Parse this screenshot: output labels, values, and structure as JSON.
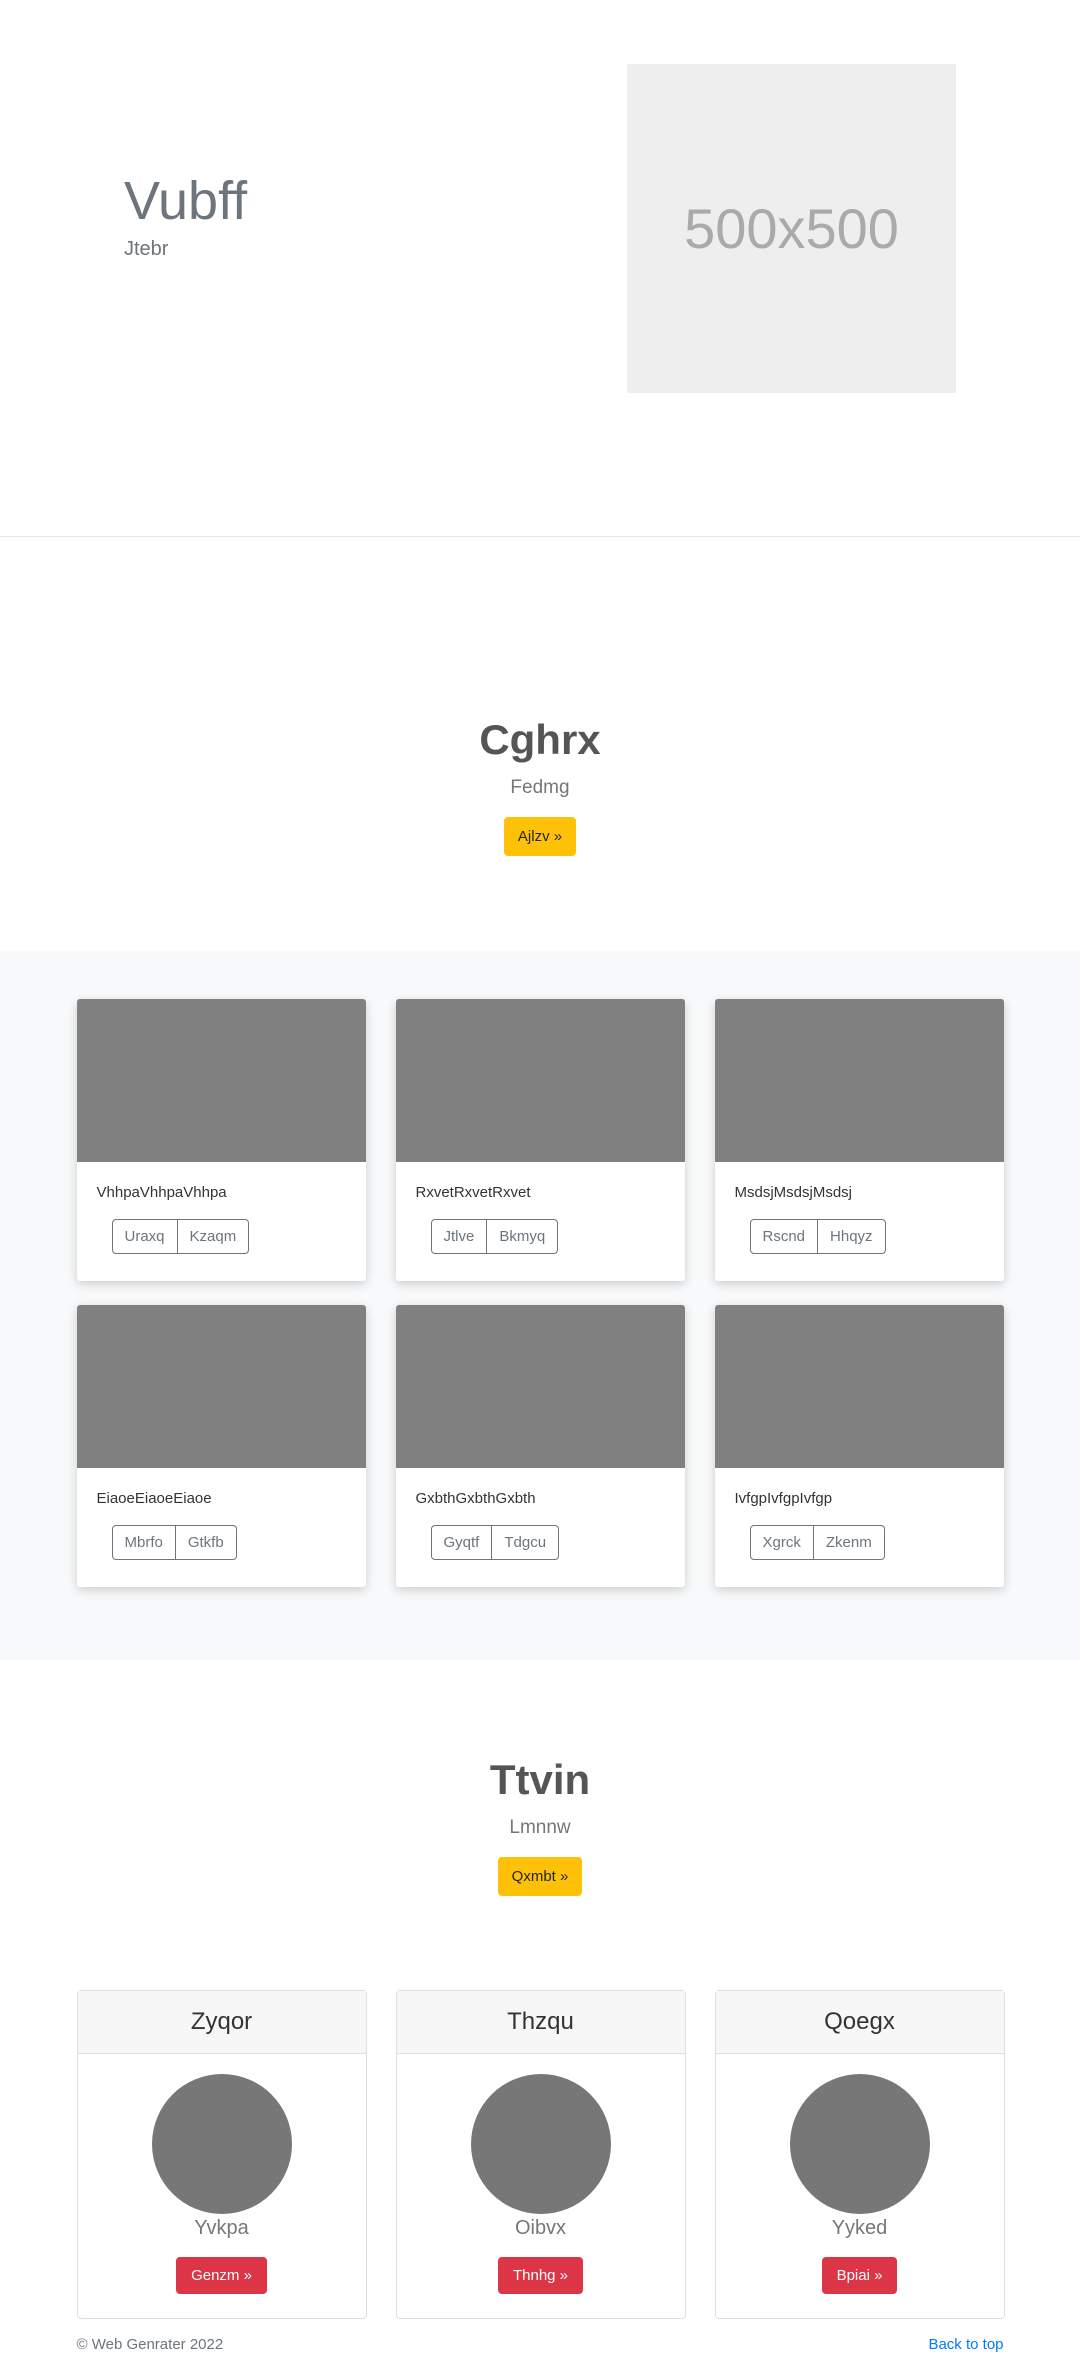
{
  "hero": {
    "title": "Vubff",
    "subtitle": "Jtebr",
    "image_placeholder": "500x500"
  },
  "cta1": {
    "title": "Cghrx",
    "subtitle": "Fedmg",
    "button": "Ajlzv »"
  },
  "album": {
    "cards": [
      {
        "text": "VhhpaVhhpaVhhpa",
        "buttons": [
          "Uraxq",
          "Kzaqm"
        ]
      },
      {
        "text": "RxvetRxvetRxvet",
        "buttons": [
          "Jtlve",
          "Bkmyq"
        ]
      },
      {
        "text": "MsdsjMsdsjMsdsj",
        "buttons": [
          "Rscnd",
          "Hhqyz"
        ]
      },
      {
        "text": "EiaoeEiaoeEiaoe",
        "buttons": [
          "Mbrfo",
          "Gtkfb"
        ]
      },
      {
        "text": "GxbthGxbthGxbth",
        "buttons": [
          "Gyqtf",
          "Tdgcu"
        ]
      },
      {
        "text": "IvfgpIvfgpIvfgp",
        "buttons": [
          "Xgrck",
          "Zkenm"
        ]
      }
    ]
  },
  "cta2": {
    "title": "Ttvin",
    "subtitle": "Lmnnw",
    "button": "Qxmbt »"
  },
  "pricing": [
    {
      "header": "Zyqor",
      "name": "Yvkpa",
      "button": "Genzm »"
    },
    {
      "header": "Thzqu",
      "name": "Oibvx",
      "button": "Thnhg »"
    },
    {
      "header": "Qoegx",
      "name": "Yyked",
      "button": "Bpiai »"
    }
  ],
  "footer": {
    "copyright": "© Web Genrater 2022",
    "back_to_top": "Back to top"
  },
  "colors": {
    "warning": "#ffc107",
    "danger": "#dc3545",
    "link": "#007bff",
    "placeholder_gray": "#808080"
  }
}
